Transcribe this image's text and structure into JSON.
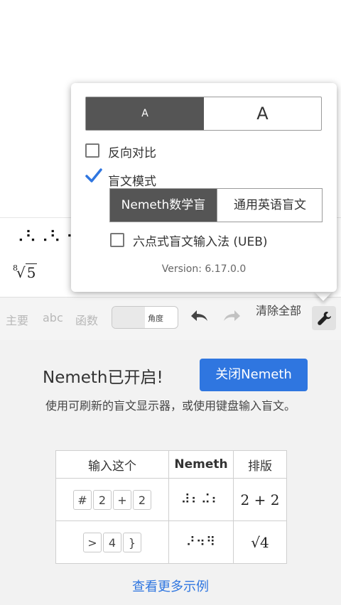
{
  "expression": {
    "braille": "⠠⠣⠠⠣⠐⠕⠆",
    "root_index": "8",
    "root_symbol": "√",
    "root_radicand": "5"
  },
  "toolbar": {
    "tab_main": "主要",
    "tab_abc": "abc",
    "tab_functions": "函数",
    "angle_label": "角度",
    "undo_icon": "undo-icon",
    "redo_icon": "redo-icon",
    "clear_all": "清除全部",
    "settings_icon": "wrench-icon"
  },
  "settings_popup": {
    "font_small": "A",
    "font_large": "A",
    "reverse_contrast": "反向对比",
    "reverse_contrast_checked": false,
    "braille_mode": "盲文模式",
    "braille_mode_checked": true,
    "code_nemeth": "Nemeth数学盲",
    "code_ueb": "通用英语盲文",
    "six_dot_input": "六点式盲文输入法 (UEB)",
    "six_dot_checked": false,
    "version": "Version: 6.17.0.0"
  },
  "nemeth_panel": {
    "title": "Nemeth已开启!",
    "close_button": "关闭Nemeth",
    "description": "使用可刷新的盲文显示器，或使用键盘输入盲文。",
    "table": {
      "headers": [
        "输入这个",
        "Nemeth",
        "排版"
      ],
      "rows": [
        {
          "keys": [
            "#",
            "2",
            "+",
            "2"
          ],
          "nemeth": "⠼⠆⠬⠆",
          "typeset": "2 + 2"
        },
        {
          "keys": [
            ">",
            "4",
            "}"
          ],
          "nemeth": "⠜⠲⠻",
          "typeset": "√4"
        }
      ]
    },
    "more_examples": "查看更多示例"
  },
  "colors": {
    "accent_blue": "#2f76e0",
    "selected_segment": "#555555",
    "panel_bg": "#f2f2f2"
  }
}
